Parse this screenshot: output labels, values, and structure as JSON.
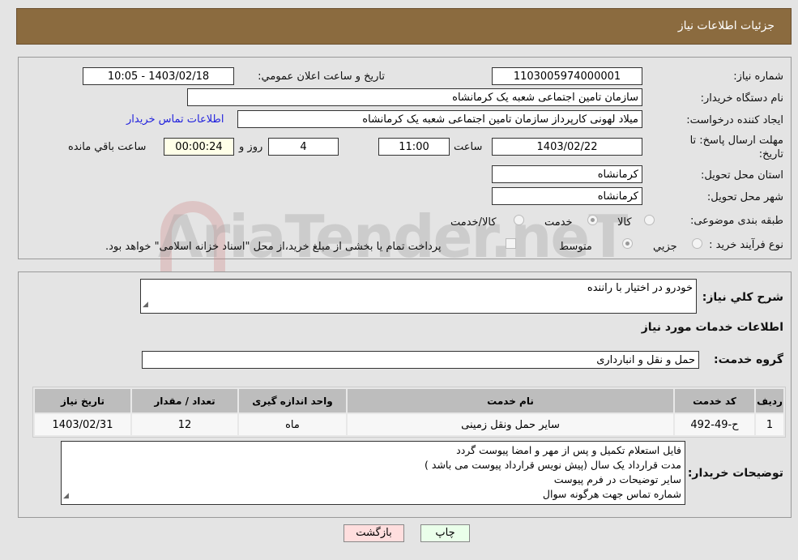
{
  "header": {
    "title": "جزئيات اطلاعات نياز"
  },
  "form": {
    "need_number_label": "شماره نياز:",
    "need_number": "1103005974000001",
    "announce_label": "تاريخ و ساعت اعلان عمومي:",
    "announce_value": "1403/02/18 - 10:05",
    "buyer_label": "نام دستگاه خريدار:",
    "buyer_value": "سازمان تامین اجتماعی شعبه یک کرمانشاه",
    "creator_label": "ايجاد كننده درخواست:",
    "creator_value": "میلاد لهونی کارپرداز  سازمان تامین اجتماعی شعبه یک کرمانشاه",
    "contact_link": "اطلاعات تماس خريدار",
    "deadline_label_1": "مهلت ارسال پاسخ: تا",
    "deadline_label_2": "تاريخ:",
    "deadline_date": "1403/02/22",
    "time_label": "ساعت",
    "deadline_time": "11:00",
    "days": "4",
    "days_label": "روز و",
    "remaining": "00:00:24",
    "remaining_label": "ساعت باقي مانده",
    "province_label": "استان محل تحويل:",
    "province": "کرمانشاه",
    "city_label": "شهر محل تحويل:",
    "city": "کرمانشاه",
    "category_label": "طبقه بندی موضوعی:",
    "category_options": [
      "كالا",
      "خدمت",
      "كالا/خدمت"
    ],
    "category_selected": "خدمت",
    "process_label": "نوع فرآيند خريد :",
    "process_options": [
      "جزيي",
      "متوسط"
    ],
    "process_selected": "متوسط",
    "payment_note": "پرداخت تمام يا بخشی از مبلغ خريد،از محل \"اسناد خزانه اسلامی\" خواهد بود."
  },
  "watermark": "AriaTender.neT",
  "details": {
    "summary_label": "شرح كلي نياز:",
    "summary": "خودرو در اختیار با راننده",
    "services_title": "اطلاعات خدمات مورد نياز",
    "group_label": "گروه خدمت:",
    "group": "حمل و نقل و انبارداری",
    "table": {
      "headers": [
        "رديف",
        "كد خدمت",
        "نام خدمت",
        "واحد اندازه گيری",
        "تعداد / مقدار",
        "تاريخ نياز"
      ],
      "rows": [
        [
          "1",
          "ح-49-492",
          "سایر حمل ونقل زمینی",
          "ماه",
          "12",
          "1403/02/31"
        ]
      ]
    },
    "buyer_notes_label": "توضيحات خريدار:",
    "buyer_notes": [
      "فایل استعلام تکمیل و پس از مهر و امضا پیوست گردد",
      "مدت قرارداد یک سال (پیش نویس قرارداد پیوست می باشد )",
      "سایر توضیحات در فرم پیوست",
      "شماره تماس جهت هرگونه سوال"
    ]
  },
  "buttons": {
    "print": "چاپ",
    "back": "بازگشت"
  },
  "colors": {
    "header": "#8b6b3f",
    "print_btn": "#eaffea",
    "back_btn": "#ffdede",
    "link": "#2222dd"
  }
}
